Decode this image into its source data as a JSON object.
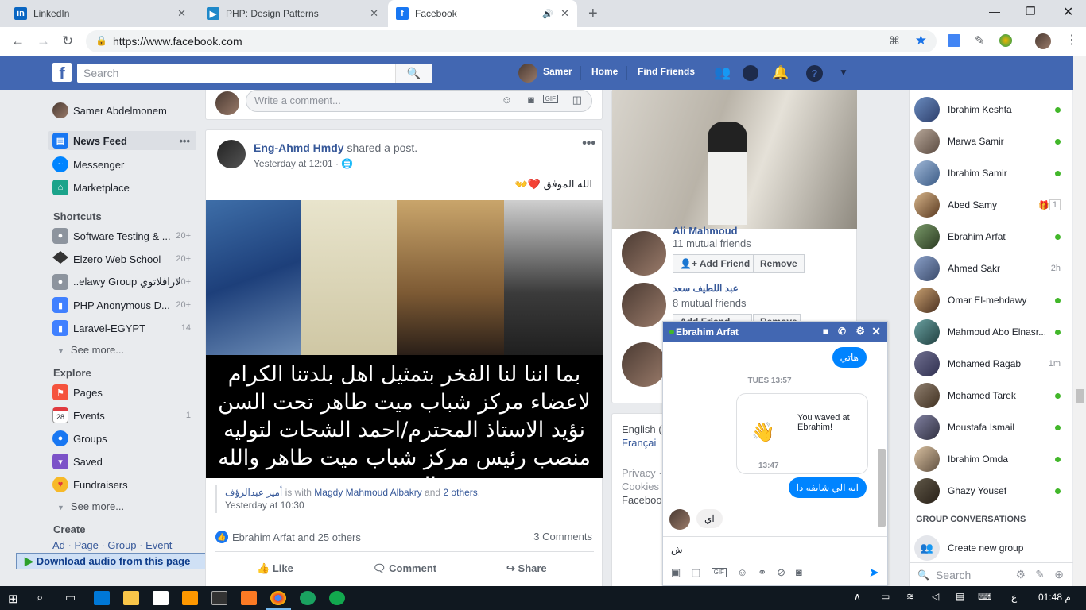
{
  "browser": {
    "tabs": [
      {
        "title": "LinkedIn",
        "icon": "linkedin-icon",
        "color": "#0a66c2"
      },
      {
        "title": "PHP: Design Patterns",
        "icon": "php-icon",
        "color": "#1e88c9"
      },
      {
        "title": "Facebook",
        "icon": "facebook-icon",
        "color": "#1877f2"
      }
    ],
    "url": "https://www.facebook.com"
  },
  "topbar": {
    "search_placeholder": "Search",
    "profile_name": "Samer",
    "home": "Home",
    "find_friends": "Find Friends"
  },
  "left_nav": {
    "profile": "Samer Abdelmonem",
    "main": [
      {
        "label": "News Feed",
        "icon": "news-feed-icon",
        "more": "•••"
      },
      {
        "label": "Messenger",
        "icon": "messenger-icon"
      },
      {
        "label": "Marketplace",
        "icon": "marketplace-icon"
      }
    ],
    "shortcuts_title": "Shortcuts",
    "shortcuts": [
      {
        "label": "Software Testing & ...",
        "count": "20+"
      },
      {
        "label": "Elzero Web School",
        "count": "20+"
      },
      {
        "label": "..elawy Group لارافلاتوي",
        "count": "20+"
      },
      {
        "label": "PHP Anonymous D...",
        "count": "20+"
      },
      {
        "label": "Laravel-EGYPT",
        "count": "14"
      }
    ],
    "see_more": "See more...",
    "explore_title": "Explore",
    "explore": [
      {
        "label": "Pages",
        "icon": "pages-icon",
        "count": ""
      },
      {
        "label": "Events",
        "icon": "events-icon",
        "count": "1",
        "day": "28"
      },
      {
        "label": "Groups",
        "icon": "groups-icon",
        "count": ""
      },
      {
        "label": "Saved",
        "icon": "saved-icon",
        "count": ""
      },
      {
        "label": "Fundraisers",
        "icon": "fundraisers-icon",
        "count": ""
      }
    ],
    "see_more2": "See more...",
    "create_title": "Create",
    "create_links": [
      "Ad",
      "Page",
      "Group",
      "Event"
    ]
  },
  "comment_box": {
    "placeholder": "Write a comment..."
  },
  "post": {
    "author": "Eng-Ahmd Hmdy",
    "action": "shared a post.",
    "time": "Yesterday at 12:01 ·",
    "caption": "الله الموفق ❤️👐",
    "image_text_lines": [
      "بما اننا لنا الفخر بتمثيل اهل بلدتنا الكرام",
      "لاعضاء مركز شباب ميت طاهر تحت السن",
      "نؤيد الاستاذ المحترم/احمد الشحات لتوليه",
      "منصب رئيس مركز شباب ميت طاهر والله الموفق"
    ],
    "shared_author": "أمير عبدالرؤف",
    "shared_with_text": "is with",
    "shared_with": "Magdy Mahmoud Albakry",
    "and_text": "and",
    "others_link": "2 others",
    "shared_time": "Yesterday at 10:30",
    "reactions": "Ebrahim Arfat and 25 others",
    "comments": "3 Comments",
    "like": "Like",
    "comment": "Comment",
    "share": "Share"
  },
  "people_you_may_know": [
    {
      "name": "Ali Mahmoud",
      "mutual": "11 mutual friends",
      "add": "Add Friend",
      "remove": "Remove"
    },
    {
      "name": "عبد اللطيف سعد",
      "mutual": "8 mutual friends",
      "add": "Add Friend",
      "remove": "Remove"
    }
  ],
  "footer": {
    "lang1": "English (",
    "lang2": "Françai",
    "privacy": "Privacy ·",
    "cookies": "Cookies",
    "facebook": "Faceboo"
  },
  "chat": {
    "name": "Ebrahim Arfat",
    "msg1": "هاتي",
    "divider": "TUES 13:57",
    "wave_text": "You waved at Ebrahim!",
    "time2": "13:47",
    "msg2": "ايه الي شايفه دا",
    "reply": "اي",
    "input": "ش"
  },
  "contacts": [
    {
      "name": "Ibrahim Keshta",
      "status": "online"
    },
    {
      "name": "Marwa Samir",
      "status": "online"
    },
    {
      "name": "Ibrahim Samir",
      "status": "online"
    },
    {
      "name": "Abed Samy",
      "status": "1"
    },
    {
      "name": "Ebrahim Arfat",
      "status": "online"
    },
    {
      "name": "Ahmed Sakr",
      "status": "2h"
    },
    {
      "name": "Omar El-mehdawy",
      "status": "online"
    },
    {
      "name": "Mahmoud Abo Elnasr...",
      "status": "online"
    },
    {
      "name": "Mohamed Ragab",
      "status": "1m"
    },
    {
      "name": "Mohamed Tarek",
      "status": "online"
    },
    {
      "name": "Moustafa Ismail",
      "status": "online"
    },
    {
      "name": "Ibrahim Omda",
      "status": "online"
    },
    {
      "name": "Ghazy Yousef",
      "status": "online"
    }
  ],
  "group_conversations": "GROUP CONVERSATIONS",
  "create_group": "Create new group",
  "contacts_search": "Search",
  "download_bar": "Download audio from this page",
  "taskbar": {
    "time": "01:48 م",
    "lang": "ع"
  }
}
